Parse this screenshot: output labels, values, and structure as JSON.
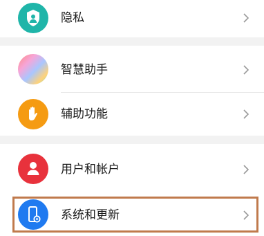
{
  "settings": {
    "items": [
      {
        "label": "隐私",
        "icon": "privacy-shield-icon"
      },
      {
        "label": "智慧助手",
        "icon": "smart-assistant-icon"
      },
      {
        "label": "辅助功能",
        "icon": "accessibility-hand-icon"
      },
      {
        "label": "用户和帐户",
        "icon": "user-account-icon"
      },
      {
        "label": "系统和更新",
        "icon": "system-update-icon"
      }
    ]
  },
  "colors": {
    "privacy": "#1fb5a9",
    "accessibility": "#f59b12",
    "user": "#e8323c",
    "system": "#1f7af0",
    "highlight_border": "#c07a4c"
  }
}
